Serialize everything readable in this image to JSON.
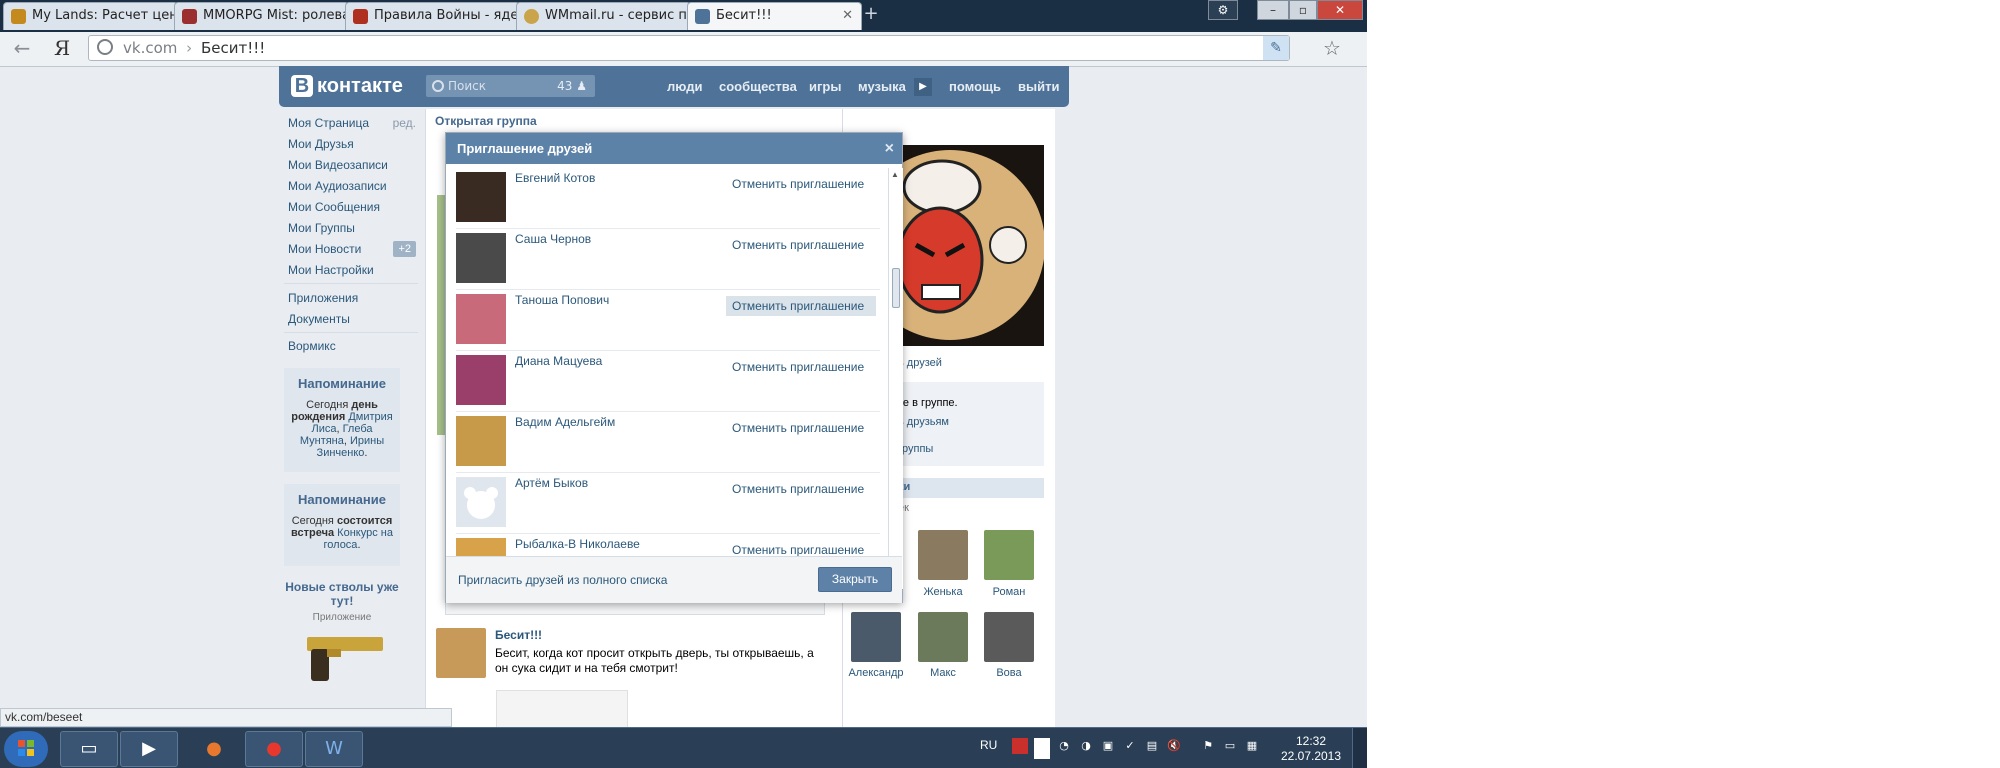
{
  "browser": {
    "tabs": [
      {
        "title": "My Lands: Расчет цены",
        "favicon_color": "#c58a1e"
      },
      {
        "title": "MMORPG Mist: ролевая",
        "favicon_color": "#9b2f2f"
      },
      {
        "title": "Правила Войны - ядерная",
        "favicon_color": "#b03020"
      },
      {
        "title": "WMmail.ru - сервис по",
        "favicon_color": "#c9a44a"
      },
      {
        "title": "Бесит!!!",
        "favicon_color": "#4f7398"
      }
    ],
    "new_tab": "+",
    "window_controls": [
      "⚙",
      "–",
      "▫",
      "✕"
    ],
    "yandex": "Я",
    "url_host": "vk.com",
    "url_sep": "›",
    "url_title": "Бесит!!!",
    "status_url": "vk.com/beseet"
  },
  "vk": {
    "logo": "контакте",
    "logo_letter": "В",
    "search_placeholder": "Поиск",
    "search_count": "43",
    "nav": [
      "люди",
      "сообщества",
      "игры",
      "музыка",
      "помощь",
      "выйти"
    ],
    "menu": [
      {
        "label": "Моя Страница",
        "extra": "ред."
      },
      {
        "label": "Мои Друзья"
      },
      {
        "label": "Мои Видеозаписи"
      },
      {
        "label": "Мои Аудиозаписи"
      },
      {
        "label": "Мои Сообщения"
      },
      {
        "label": "Мои Группы"
      },
      {
        "label": "Мои Новости",
        "badge": "+2"
      },
      {
        "label": "Мои Настройки"
      },
      {
        "label": "Приложения"
      },
      {
        "label": "Документы"
      },
      {
        "label": "Вормикс"
      }
    ],
    "reminders": [
      {
        "title": "Напоминание",
        "text_a": "Сегодня",
        "text_b": "день рождения",
        "link_a": "Дмитрия Лиса",
        "sep": ",",
        "link_b": "Глеба Мунтяна",
        "sep2": ",",
        "link_c": "Ирины Зинченко",
        "end": "."
      },
      {
        "title": "Напоминание",
        "text_a": "Сегодня",
        "text_b": "состоится встреча",
        "link_a": "Конкурс на голоса",
        "end": "."
      }
    ],
    "promo": {
      "title": "Новые стволы уже тут!",
      "subtitle": "Приложение"
    },
    "group_type": "Открытая группа",
    "right": {
      "invite_friends": "ь друзей",
      "in_group": "те в группе.",
      "to_friends": "ь друзьям",
      "group": "группы",
      "section": "ки",
      "people": "ек",
      "members": [
        "Женька",
        "Роман",
        "Александр",
        "Макс",
        "Вова"
      ]
    },
    "post": {
      "author": "Бесит!!!",
      "text": "Бесит, когда кот просит открыть дверь, ты открываешь, а он сука сидит и на тебя смотрит!"
    },
    "modal": {
      "title": "Приглашение друзей",
      "close_icon": "×",
      "friends": [
        {
          "name": "Евгений Котов",
          "action": "Отменить приглашение",
          "photo_color": "#3a2b22"
        },
        {
          "name": "Саша Чернов",
          "action": "Отменить приглашение",
          "photo_color": "#4a4a4a"
        },
        {
          "name": "Таноша Попович",
          "action": "Отменить приглашение",
          "photo_color": "#c86a7a"
        },
        {
          "name": "Диана Мацуева",
          "action": "Отменить приглашение",
          "photo_color": "#9a3f6a"
        },
        {
          "name": "Вадим Адельгейм",
          "action": "Отменить приглашение",
          "photo_color": "#c79a4a"
        },
        {
          "name": "Артём Быков",
          "action": "Отменить приглашение",
          "photo_color": "#dfe6ee"
        },
        {
          "name": "Рыбалка-В Николаеве",
          "action": "Отменить приглашение",
          "photo_color": "#d8a24a"
        }
      ],
      "footer_link": "Пригласить друзей из полного списка",
      "close_button": "Закрыть"
    }
  },
  "taskbar": {
    "lang": "RU",
    "time": "12:32",
    "date": "22.07.2013"
  },
  "colors": {
    "vk_blue": "#4f7398",
    "modal_header": "#5d82a8",
    "link": "#2b587a",
    "taskbar": "#2a3f56"
  }
}
